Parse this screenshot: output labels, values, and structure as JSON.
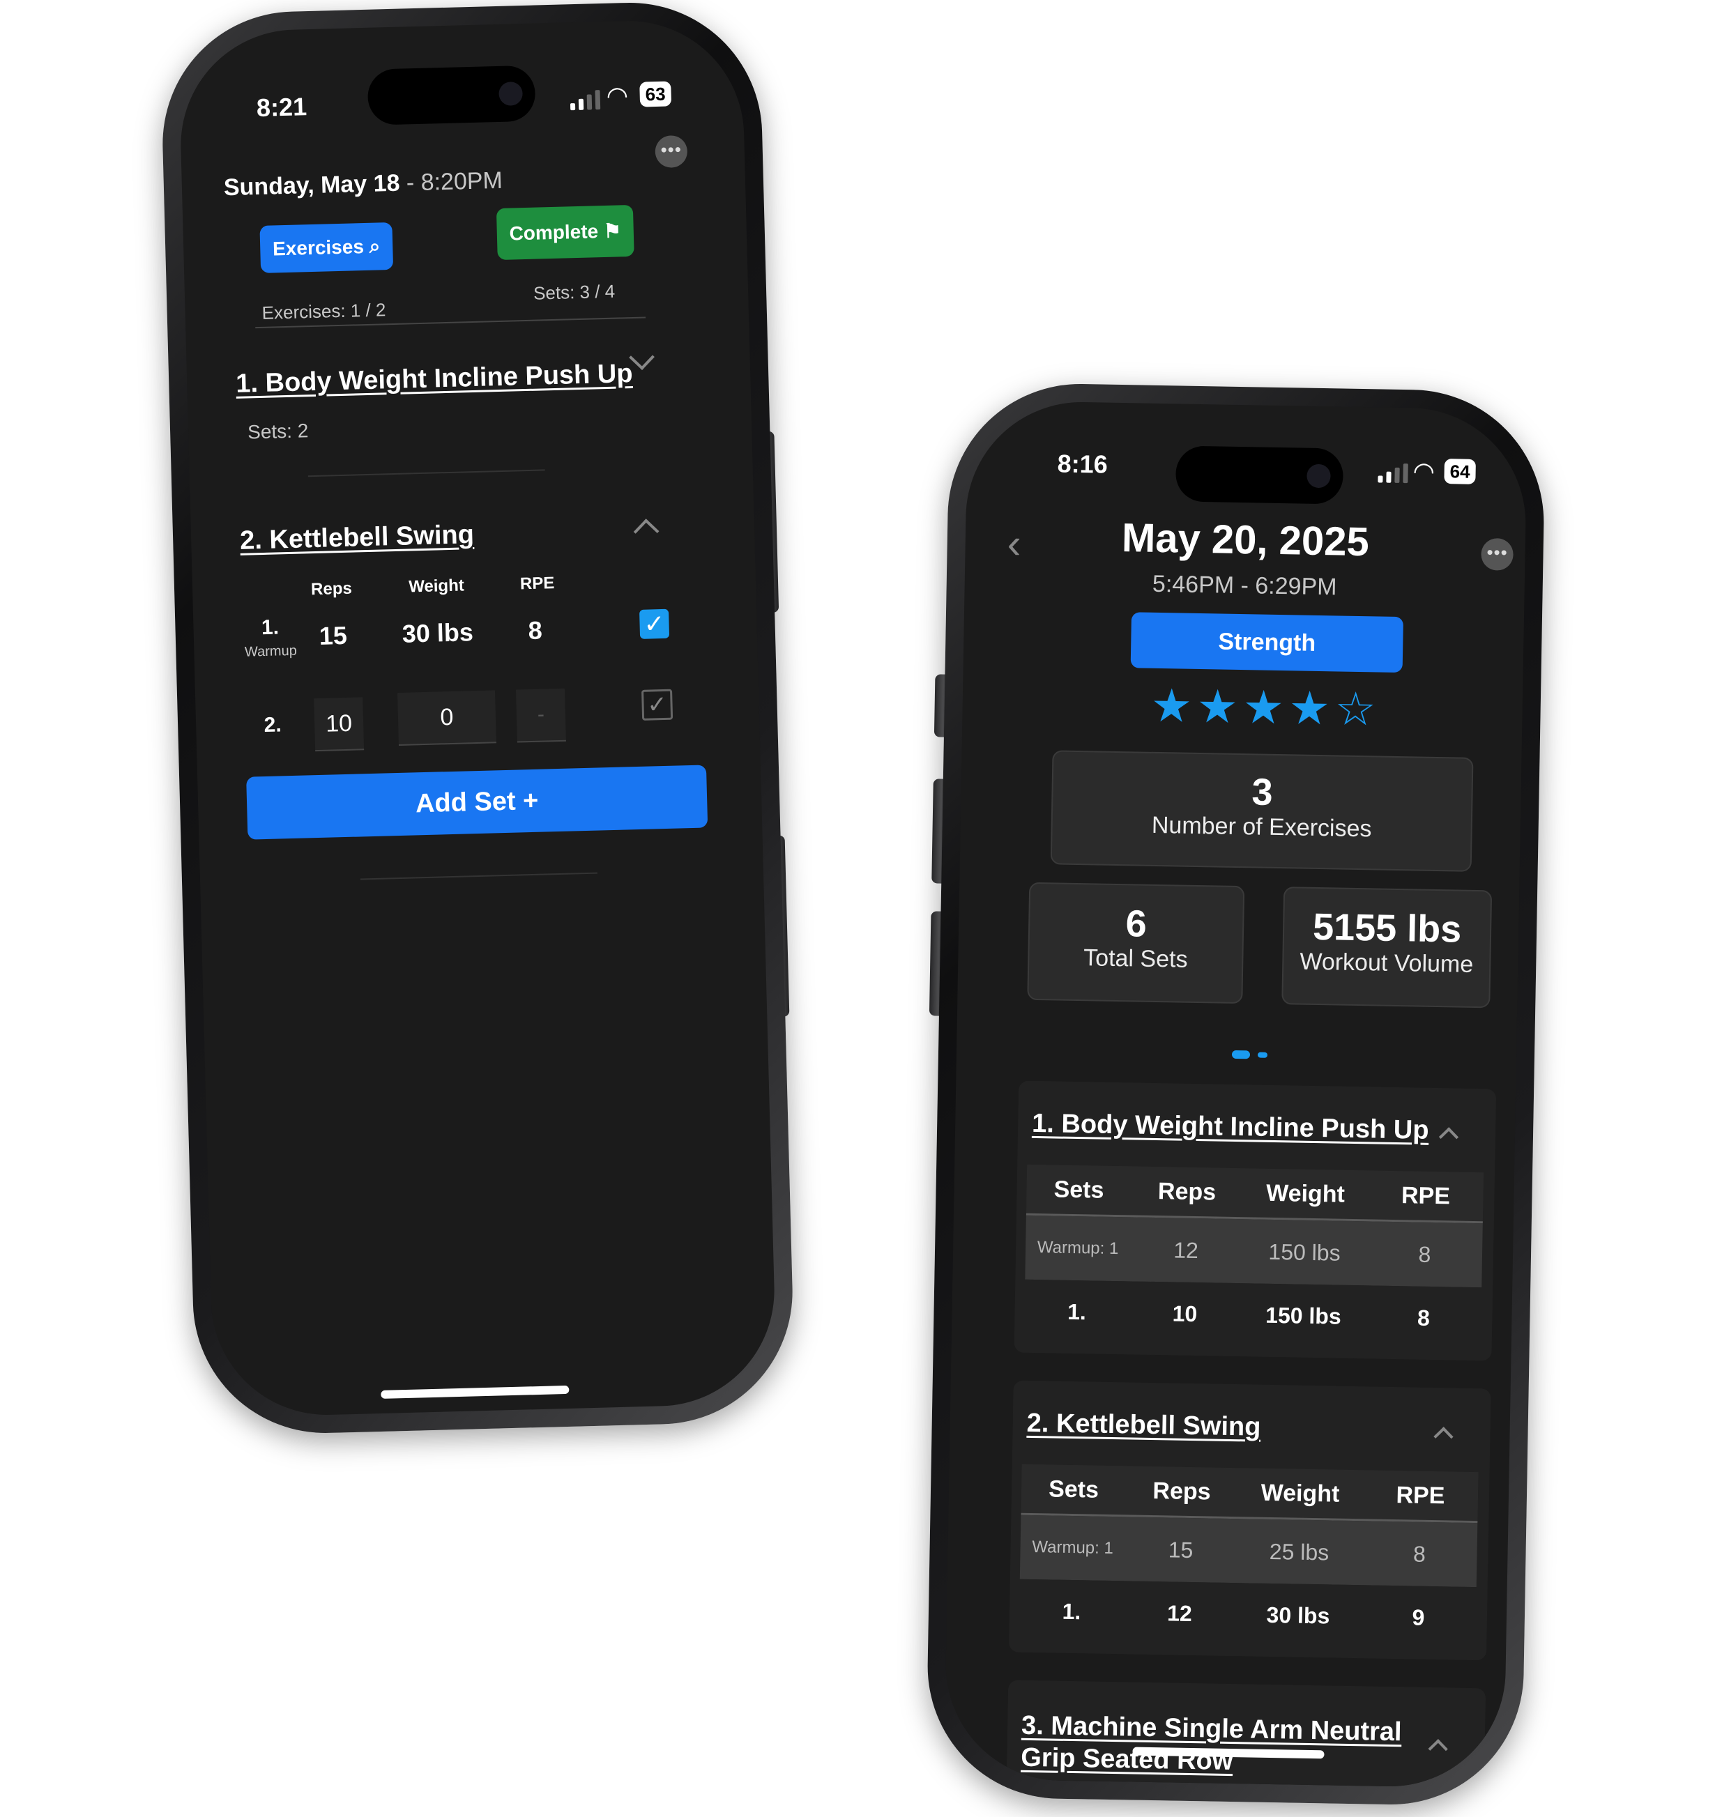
{
  "phone_left": {
    "status": {
      "time": "8:21",
      "battery": "63"
    },
    "header": {
      "date": "Sunday, May 18",
      "time": " - 8:20PM"
    },
    "buttons": {
      "exercises": "Exercises",
      "complete": "Complete"
    },
    "progress": {
      "exercises": "Exercises: 1 / 2",
      "sets": "Sets: 3 / 4"
    },
    "exercises": [
      {
        "title": "1. Body Weight Incline Push Up",
        "sets": "Sets: 2"
      },
      {
        "title": "2. Kettlebell Swing"
      }
    ],
    "set_table": {
      "headers": [
        "Reps",
        "Weight",
        "RPE"
      ],
      "rows": [
        {
          "num": "1.",
          "tag": "Warmup",
          "reps": "15",
          "weight": "30 lbs",
          "rpe": "8",
          "checked": true
        },
        {
          "num": "2.",
          "reps": "10",
          "weight": "0",
          "rpe": "-",
          "checked": false
        }
      ]
    },
    "add_set": "Add Set +"
  },
  "phone_right": {
    "status": {
      "time": "8:16",
      "battery": "64"
    },
    "header": {
      "date": "May 20, 2025",
      "time_range": "5:46PM - 6:29PM"
    },
    "type_button": "Strength",
    "rating": 4,
    "rating_max": 5,
    "stats": {
      "exercises": {
        "value": "3",
        "label": "Number of Exercises"
      },
      "sets": {
        "value": "6",
        "label": "Total Sets"
      },
      "volume": {
        "value": "5155 lbs",
        "label": "Workout Volume"
      }
    },
    "table_headers": [
      "Sets",
      "Reps",
      "Weight",
      "RPE"
    ],
    "exercises": [
      {
        "title": "1. Body Weight Incline Push Up",
        "rows": [
          {
            "set": "Warmup: 1",
            "reps": "12",
            "weight": "150 lbs",
            "rpe": "8"
          },
          {
            "set": "1.",
            "reps": "10",
            "weight": "150 lbs",
            "rpe": "8"
          }
        ]
      },
      {
        "title": "2. Kettlebell Swing",
        "rows": [
          {
            "set": "Warmup: 1",
            "reps": "15",
            "weight": "25 lbs",
            "rpe": "8"
          },
          {
            "set": "1.",
            "reps": "12",
            "weight": "30 lbs",
            "rpe": "9"
          }
        ]
      },
      {
        "title_line1": "3. Machine Single Arm Neutral",
        "title_line2": "Grip Seated Row"
      }
    ]
  },
  "colors": {
    "accent_blue": "#1976f2",
    "complete_green": "#1e8e3e",
    "star_blue": "#1a9bf0",
    "screen_bg": "#1b1b1b"
  }
}
